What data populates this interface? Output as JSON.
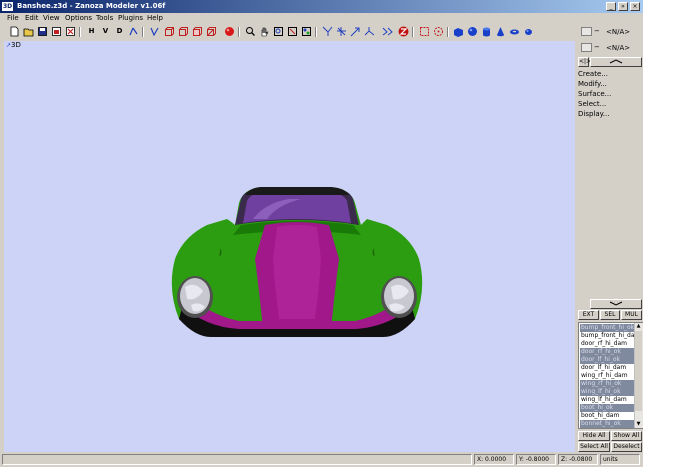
{
  "window": {
    "app_badge": "3D",
    "title": "Banshee.z3d - Zanoza Modeler v1.06f",
    "min": "_",
    "max": "»",
    "close": "×"
  },
  "menu": [
    "File",
    "Edit",
    "View",
    "Options",
    "Tools",
    "Plugins",
    "Help"
  ],
  "toolbar": {
    "views": [
      "H",
      "V",
      "D"
    ]
  },
  "viewport": {
    "label": "3D",
    "background": "#ccd3f6"
  },
  "car": {
    "body_color": "#2c9d10",
    "stripe_color": "#a0188a",
    "shadow_color": "#0c0c0c"
  },
  "side": {
    "slot1": "<N/A>",
    "slot2": "<N/A>",
    "nav_left": "<|>",
    "menu": [
      "Create...",
      "Modify...",
      "Surface...",
      "Select...",
      "Display..."
    ],
    "modes": [
      "EXT",
      "SEL",
      "MUL"
    ],
    "objects": [
      {
        "name": "bump_front_hi_ok",
        "selected": true
      },
      {
        "name": "bump_front_hi_dam",
        "selected": false
      },
      {
        "name": "door_rf_hi_dam",
        "selected": false
      },
      {
        "name": "door_rf_hi_ok",
        "selected": true
      },
      {
        "name": "door_lf_hi_ok",
        "selected": true
      },
      {
        "name": "door_lf_hi_dam",
        "selected": false
      },
      {
        "name": "wing_rf_hi_dam",
        "selected": false
      },
      {
        "name": "wing_rf_hi_ok",
        "selected": true
      },
      {
        "name": "wing_lf_hi_ok",
        "selected": true
      },
      {
        "name": "wing_lf_hi_dam",
        "selected": false
      },
      {
        "name": "boot_hi_ok",
        "selected": true
      },
      {
        "name": "boot_hi_dam",
        "selected": false
      },
      {
        "name": "bonnet_hi_ok",
        "selected": true
      }
    ],
    "hide_all": "Hide All",
    "show_all": "Show All",
    "select_all": "Select All",
    "deselect": "Deselect"
  },
  "status": {
    "x": "X: 0.0000",
    "y": "Y: -0.8000",
    "z": "Z: -0.0800",
    "units": "units"
  }
}
